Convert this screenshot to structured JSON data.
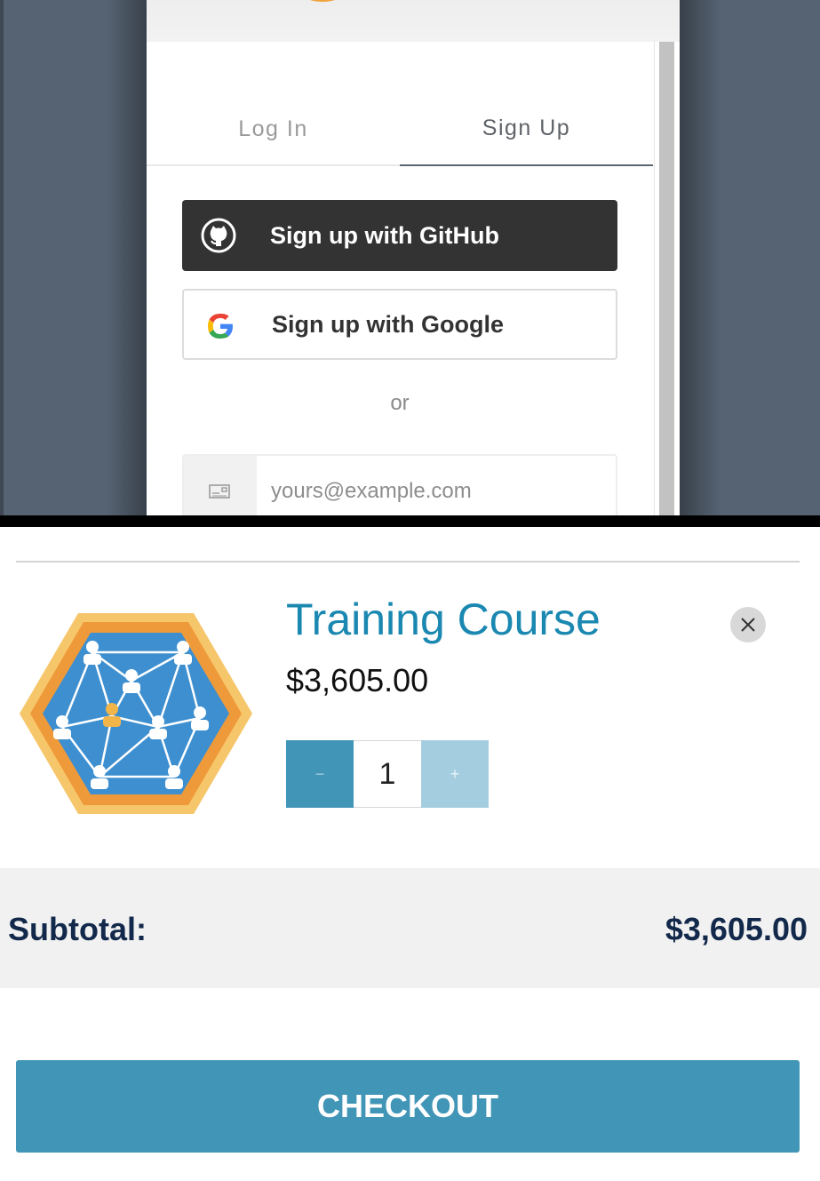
{
  "auth": {
    "tabs": [
      {
        "label": "Log In",
        "active": false
      },
      {
        "label": "Sign Up",
        "active": true
      }
    ],
    "github_label": "Sign up with GitHub",
    "google_label": "Sign up with Google",
    "separator": "or",
    "email_placeholder": "yours@example.com",
    "icons": [
      "github-icon",
      "google-icon",
      "envelope-icon"
    ]
  },
  "cart": {
    "item": {
      "title": "Training Course",
      "price": "$3,605.00",
      "quantity": "1",
      "minus_label": "−",
      "plus_label": "+",
      "image": "network-hexagon-badge"
    },
    "subtotal_label": "Subtotal:",
    "subtotal_value": "$3,605.00",
    "checkout_label": "CHECKOUT"
  },
  "colors": {
    "accent": "#4195b6",
    "title_blue": "#1a88b0",
    "navy": "#13294b",
    "github_bg": "#333333",
    "backdrop": "#566372"
  }
}
